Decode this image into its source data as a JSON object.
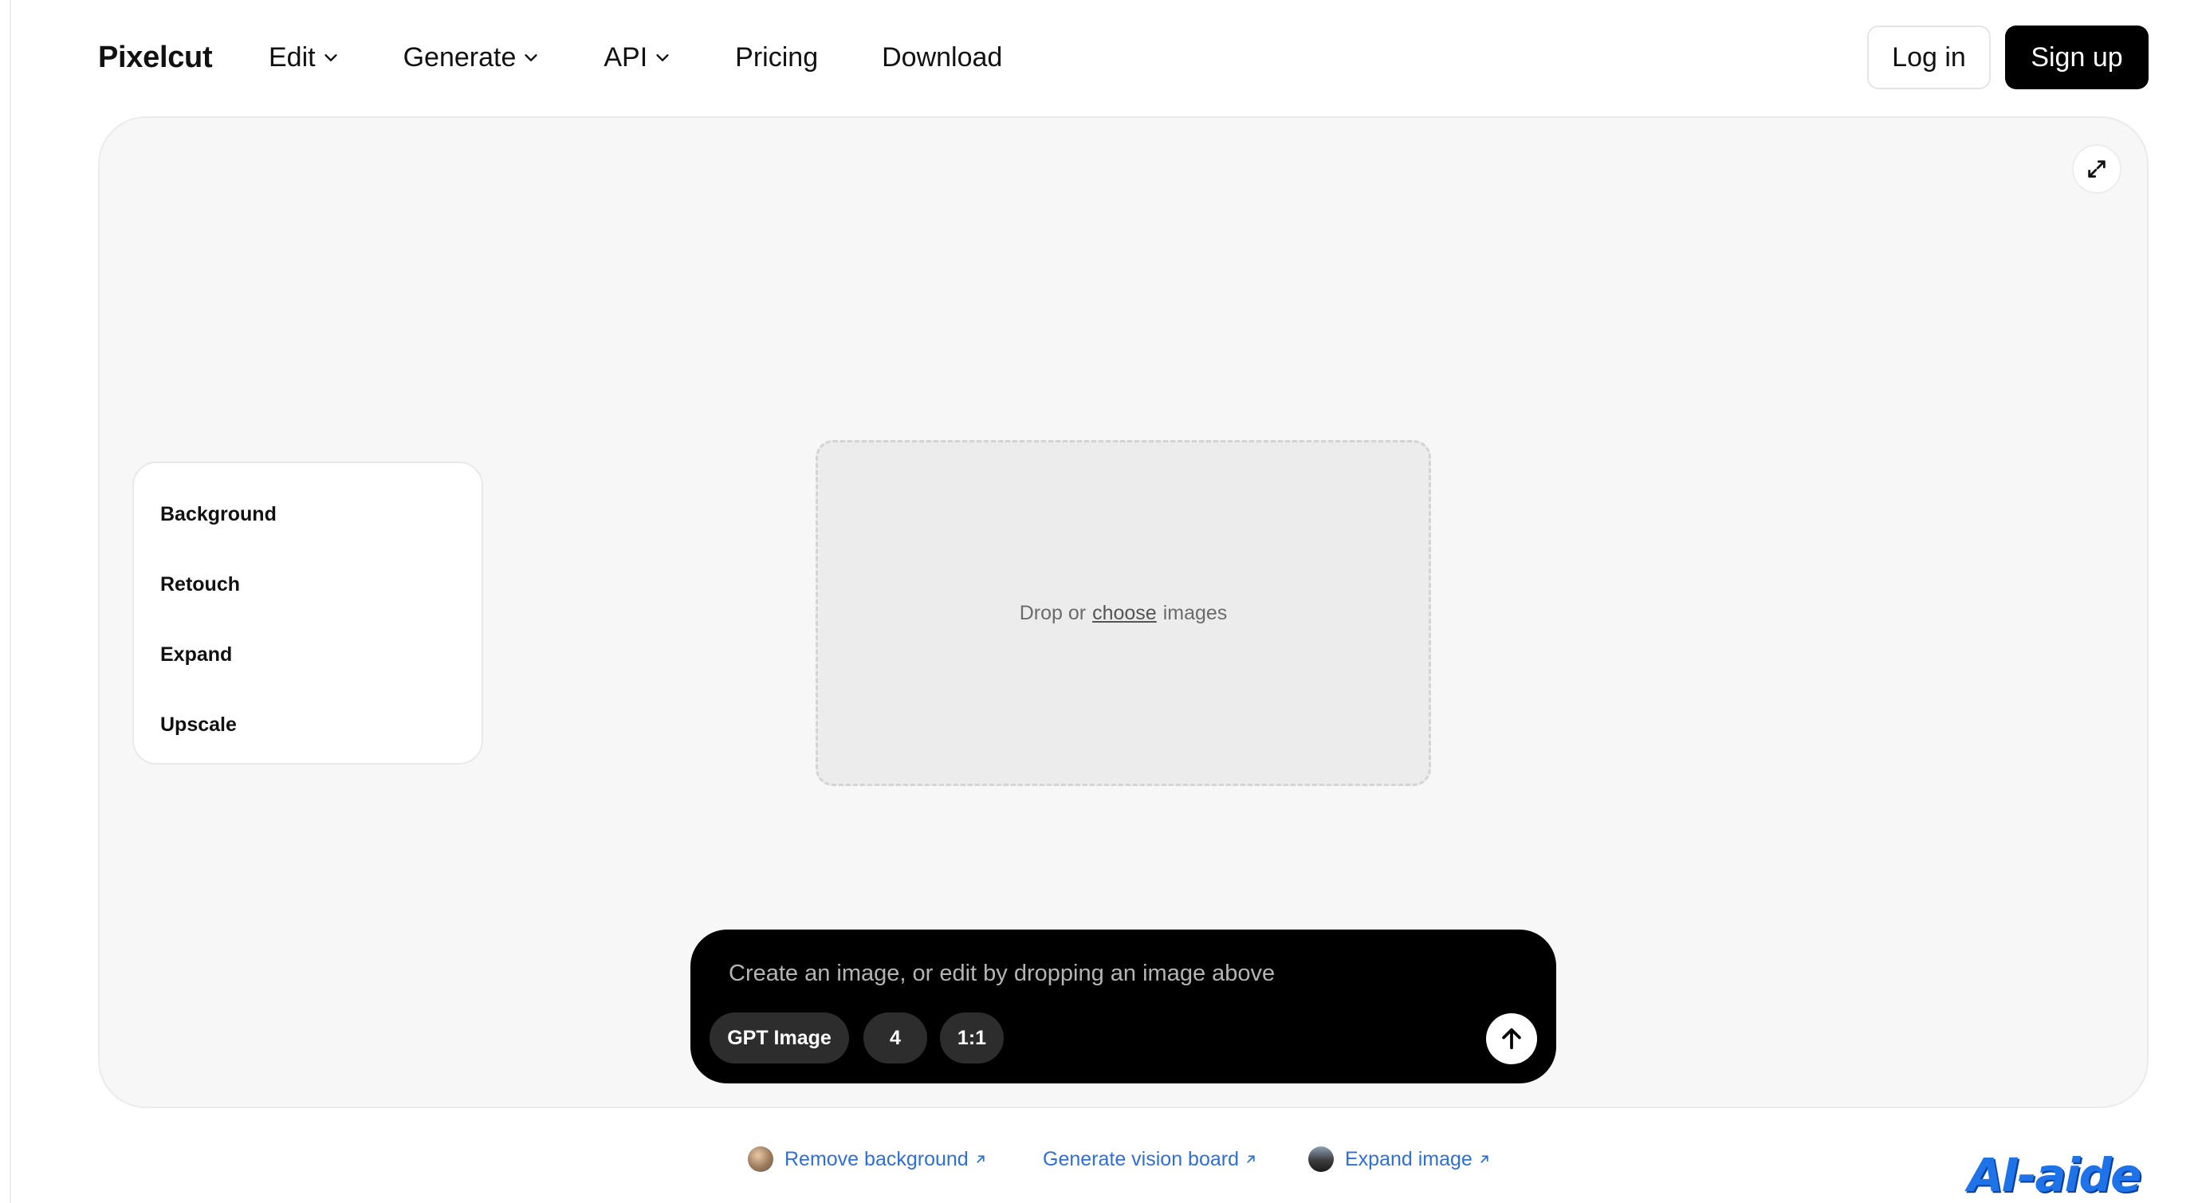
{
  "header": {
    "logo": "Pixelcut",
    "nav": [
      {
        "label": "Edit",
        "has_dropdown": true
      },
      {
        "label": "Generate",
        "has_dropdown": true
      },
      {
        "label": "API",
        "has_dropdown": true
      },
      {
        "label": "Pricing",
        "has_dropdown": false
      },
      {
        "label": "Download",
        "has_dropdown": false
      }
    ],
    "login_label": "Log in",
    "signup_label": "Sign up"
  },
  "canvas": {
    "expand_icon": "expand-arrows-icon",
    "tools": [
      "Background",
      "Retouch",
      "Expand",
      "Upscale"
    ],
    "dropzone": {
      "prefix": "Drop or",
      "link": "choose",
      "suffix": "images"
    }
  },
  "prompt": {
    "placeholder": "Create an image, or edit by dropping an image above",
    "model": "GPT Image",
    "count": "4",
    "ratio": "1:1",
    "send_icon": "arrow-up-icon"
  },
  "quick_links": [
    {
      "label": "Remove background",
      "thumb": "thumb-portrait"
    },
    {
      "label": "Generate vision board",
      "thumb": ""
    },
    {
      "label": "Expand image",
      "thumb": "thumb-landscape"
    }
  ],
  "watermark": "AI-aide",
  "colors": {
    "accent_link": "#2f6fd8",
    "prompt_bg": "#000000",
    "canvas_bg": "#f7f7f7",
    "watermark": "#1f73e8"
  }
}
